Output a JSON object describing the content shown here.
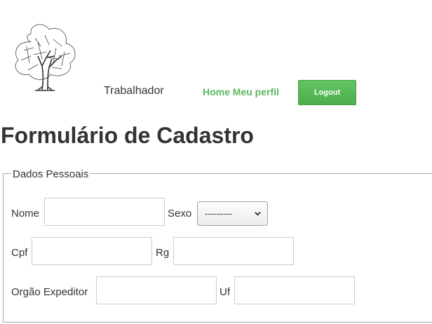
{
  "header": {
    "role_label": "Trabalhador",
    "nav": {
      "home": "Home",
      "profile": "Meu perfil"
    },
    "logout_label": "Logout",
    "logo_icon": "tree-logo-icon"
  },
  "page": {
    "title": "Formulário de Cadastro"
  },
  "form": {
    "legend": "Dados Pessoais",
    "nome_label": "Nome",
    "nome_value": "",
    "sexo_label": "Sexo",
    "sexo_selected": "---------",
    "cpf_label": "Cpf",
    "cpf_value": "",
    "rg_label": "Rg",
    "rg_value": "",
    "orgao_label": "Orgão Expeditor",
    "orgao_value": "",
    "uf_label": "Uf",
    "uf_value": ""
  },
  "colors": {
    "accent": "#5cb85c",
    "text": "#333333",
    "border": "#cccccc"
  }
}
